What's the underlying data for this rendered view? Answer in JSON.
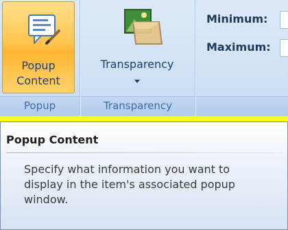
{
  "ribbon": {
    "popup_group": {
      "button_line1": "Popup",
      "button_line2": "Content",
      "group_label": "Popup",
      "icon": "popup-content-icon"
    },
    "transparency_group": {
      "button_label": "Transparency",
      "group_label": "Transparency",
      "icon": "transparency-icon"
    },
    "range_group": {
      "minimum_label": "Minimum:",
      "maximum_label": "Maximum:"
    }
  },
  "tooltip": {
    "title": "Popup Content",
    "description": "Specify what information you want to display in the item's associated popup window."
  },
  "colors": {
    "background": "#fefd14",
    "ribbon": "#d3e3f6",
    "button_active": "#ffc54d",
    "label_text": "#15428b"
  }
}
